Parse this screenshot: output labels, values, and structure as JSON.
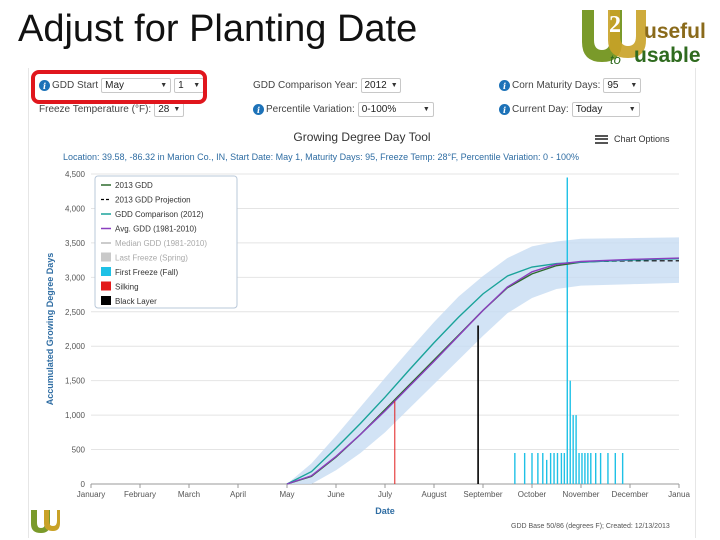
{
  "slide": {
    "title": "Adjust for Planting Date"
  },
  "logo": {
    "text1": "useful",
    "text2": "to",
    "text3": "usable"
  },
  "controls": {
    "gdd_start_label": "GDD Start",
    "gdd_start_month": "May",
    "gdd_start_day": "1",
    "freeze_temp_label": "Freeze Temperature (°F):",
    "freeze_temp_value": "28",
    "comparison_year_label": "GDD Comparison Year:",
    "comparison_year_value": "2012",
    "percentile_label": "Percentile Variation:",
    "percentile_value": "0-100%",
    "maturity_label": "Corn Maturity Days:",
    "maturity_value": "95",
    "current_day_label": "Current Day:",
    "current_day_value": "Today"
  },
  "tool": {
    "title": "Growing Degree Day Tool",
    "chart_options": "Chart Options",
    "location_line": "Location: 39.58, -86.32 in Marion Co., IN, Start Date: May 1, Maturity Days: 95, Freeze Temp: 28°F, Percentile Variation: 0 - 100%",
    "footer": "GDD Base 50/86 (degrees F); Created: 12/13/2013"
  },
  "colors": {
    "gdd_2013": "#2e6b2e",
    "projection": "#000000",
    "comparison": "#1aa39a",
    "avg": "#8a3fbf",
    "median": "#bbbbbb",
    "last_freeze": "#c9c9c9",
    "first_freeze": "#1ec1e6",
    "silking": "#e21b1b",
    "black_layer": "#000000",
    "band": "#c7dcf3",
    "highlight": "#e0161d"
  },
  "chart_data": {
    "type": "line",
    "title": "",
    "xlabel": "Date",
    "ylabel": "Accumulated Growing Degree Days",
    "ylim": [
      0,
      4500
    ],
    "yticks": [
      "0",
      "500",
      "1,000",
      "1,500",
      "2,000",
      "2,500",
      "3,000",
      "3,500",
      "4,000",
      "4,500"
    ],
    "months": [
      "January",
      "February",
      "March",
      "April",
      "May",
      "June",
      "July",
      "August",
      "September",
      "October",
      "November",
      "December",
      "Janua"
    ],
    "grid": true,
    "legend_position": "top-left",
    "legend": [
      {
        "label": "2013 GDD",
        "kind": "line",
        "color": "#2e6b2e"
      },
      {
        "label": "2013 GDD Projection",
        "kind": "dash",
        "color": "#000000"
      },
      {
        "label": "GDD Comparison (2012)",
        "kind": "line",
        "color": "#1aa39a"
      },
      {
        "label": "Avg. GDD (1981-2010)",
        "kind": "line",
        "color": "#8a3fbf"
      },
      {
        "label": "Median GDD (1981-2010)",
        "kind": "line",
        "color": "#bbbbbb"
      },
      {
        "label": "Last Freeze (Spring)",
        "kind": "box",
        "color": "#c9c9c9"
      },
      {
        "label": "First Freeze (Fall)",
        "kind": "box",
        "color": "#1ec1e6"
      },
      {
        "label": "Silking",
        "kind": "box",
        "color": "#e21b1b"
      },
      {
        "label": "Black Layer",
        "kind": "box",
        "color": "#000000"
      }
    ],
    "series": [
      {
        "name": "2013 GDD",
        "x": [
          4.0,
          4.5,
          5.0,
          5.5,
          6.0,
          6.5,
          7.0,
          7.5,
          8.0,
          8.5,
          9.0,
          9.5,
          10.0,
          10.3
        ],
        "y": [
          0,
          110,
          390,
          720,
          1080,
          1440,
          1800,
          2160,
          2520,
          2850,
          3050,
          3170,
          3220,
          3230
        ]
      },
      {
        "name": "2013 GDD Projection",
        "x": [
          10.3,
          11.0,
          11.5,
          12.0
        ],
        "y": [
          3230,
          3240,
          3240,
          3240
        ]
      },
      {
        "name": "GDD Comparison (2012)",
        "x": [
          4.0,
          4.5,
          5.0,
          5.5,
          6.0,
          6.5,
          7.0,
          7.5,
          8.0,
          8.5,
          9.0,
          9.5,
          10.0,
          11.0,
          12.0
        ],
        "y": [
          0,
          180,
          520,
          880,
          1260,
          1660,
          2050,
          2420,
          2760,
          3020,
          3150,
          3200,
          3220,
          3250,
          3270
        ]
      },
      {
        "name": "Avg. GDD (1981-2010)",
        "x": [
          4.0,
          4.5,
          5.0,
          5.5,
          6.0,
          6.5,
          7.0,
          7.5,
          8.0,
          8.5,
          9.0,
          9.5,
          10.0,
          11.0,
          12.0
        ],
        "y": [
          0,
          120,
          400,
          720,
          1060,
          1420,
          1780,
          2150,
          2520,
          2860,
          3080,
          3190,
          3230,
          3260,
          3280
        ]
      }
    ],
    "band_upper": {
      "x": [
        4.0,
        4.5,
        5.0,
        5.5,
        6.0,
        6.5,
        7.0,
        7.5,
        8.0,
        8.5,
        9.0,
        9.5,
        10.0,
        11.0,
        12.0
      ],
      "y": [
        0,
        300,
        700,
        1120,
        1540,
        1950,
        2350,
        2720,
        3020,
        3280,
        3450,
        3520,
        3560,
        3570,
        3580
      ]
    },
    "band_lower": {
      "x": [
        4.0,
        4.5,
        5.0,
        5.5,
        6.0,
        6.5,
        7.0,
        7.5,
        8.0,
        8.5,
        9.0,
        9.5,
        10.0,
        11.0,
        12.0
      ],
      "y": [
        0,
        0,
        200,
        450,
        750,
        1100,
        1450,
        1800,
        2150,
        2480,
        2700,
        2830,
        2880,
        2900,
        2920
      ]
    },
    "markers": [
      {
        "name": "Silking",
        "x": 6.2,
        "y": 1200,
        "color": "#e21b1b"
      },
      {
        "name": "Black Layer",
        "x": 7.9,
        "y": 2300,
        "color": "#000000"
      }
    ],
    "first_freeze_bars": {
      "x": [
        8.65,
        8.85,
        9.0,
        9.12,
        9.22,
        9.3,
        9.38,
        9.45,
        9.52,
        9.6,
        9.66,
        9.72,
        9.78,
        9.84,
        9.9,
        9.96,
        10.02,
        10.08,
        10.14,
        10.2,
        10.3,
        10.4,
        10.55,
        10.7,
        10.85
      ],
      "y": [
        450,
        450,
        450,
        450,
        450,
        350,
        450,
        450,
        450,
        450,
        450,
        4450,
        1500,
        1000,
        1000,
        450,
        450,
        450,
        450,
        450,
        450,
        450,
        450,
        450,
        450
      ]
    }
  }
}
